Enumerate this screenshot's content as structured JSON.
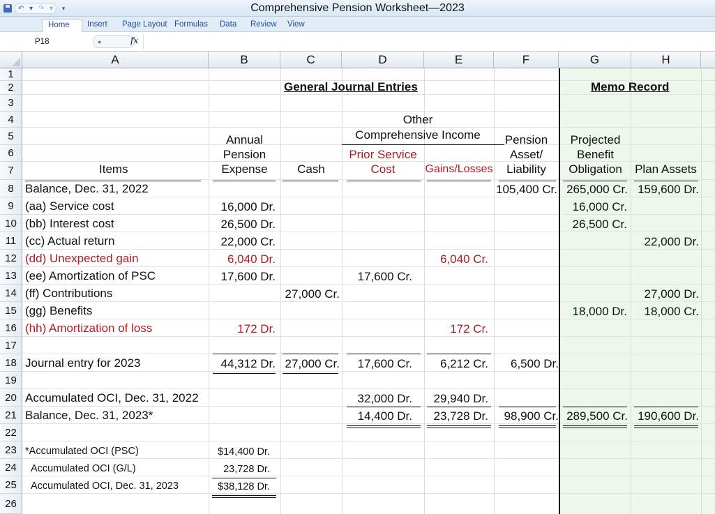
{
  "window": {
    "title": "Comprehensive Pension Worksheet—2023"
  },
  "ribbon": {
    "tabs": [
      "Home",
      "Insert",
      "Page Layout",
      "Formulas",
      "Data",
      "Review",
      "View"
    ]
  },
  "formula_bar": {
    "cell_ref": "P18",
    "fx": "fx",
    "value": ""
  },
  "columns": [
    "A",
    "B",
    "C",
    "D",
    "E",
    "F",
    "G",
    "H"
  ],
  "rows": [
    "1",
    "2",
    "3",
    "4",
    "5",
    "6",
    "7",
    "8",
    "9",
    "10",
    "11",
    "12",
    "13",
    "14",
    "15",
    "16",
    "17",
    "18",
    "19",
    "20",
    "21",
    "22",
    "23",
    "24",
    "25",
    "26"
  ],
  "headers": {
    "general_journal": "General Journal Entries",
    "memo_record": "Memo Record",
    "other_line1": "Other",
    "other_line2": "Comprehensive Income",
    "annual_1": "Annual",
    "annual_2": "Pension",
    "annual_3": "Expense",
    "cash": "Cash",
    "psc_1": "Prior Service",
    "psc_2": "Cost",
    "gains": "Gains/Losses",
    "pal_1": "Pension",
    "pal_2": "Asset/",
    "pal_3": "Liability",
    "pbo_1": "Projected",
    "pbo_2": "Benefit",
    "pbo_3": "Obligation",
    "plan": "Plan Assets",
    "items": "Items"
  },
  "entries": {
    "r8": {
      "item": "Balance, Dec. 31, 2022",
      "f": "105,400 Cr.",
      "g": "265,000 Cr.",
      "h": "159,600 Dr."
    },
    "r9": {
      "item": "(aa) Service cost",
      "b": "16,000 Dr.",
      "g": "16,000 Cr."
    },
    "r10": {
      "item": "(bb) Interest cost",
      "b": "26,500 Dr.",
      "g": "26,500 Cr."
    },
    "r11": {
      "item": "(cc) Actual return",
      "b": "22,000 Cr.",
      "h": "22,000 Dr."
    },
    "r12": {
      "item": "(dd) Unexpected gain",
      "b": "6,040 Dr.",
      "e": "6,040 Cr."
    },
    "r13": {
      "item": "(ee) Amortization of PSC",
      "b": "17,600 Dr.",
      "d": "17,600 Cr."
    },
    "r14": {
      "item": "(ff) Contributions",
      "c": "27,000 Cr.",
      "h": "27,000 Dr."
    },
    "r15": {
      "item": "(gg) Benefits",
      "g": "18,000 Dr.",
      "h": "18,000 Cr."
    },
    "r16": {
      "item": "(hh) Amortization of loss",
      "b": "172 Dr.",
      "e": "172 Cr."
    },
    "r18": {
      "item": "Journal entry for 2023",
      "b": "44,312 Dr.",
      "c": "27,000 Cr.",
      "d": "17,600 Cr.",
      "e": "6,212 Cr.",
      "f": "6,500 Dr."
    },
    "r20": {
      "item": "Accumulated OCI, Dec. 31, 2022",
      "d": "32,000 Dr.",
      "e": "29,940 Dr."
    },
    "r21": {
      "item": "Balance, Dec. 31, 2023*",
      "d": "14,400 Dr.",
      "e": "23,728 Dr.",
      "f": "98,900 Cr.",
      "g": "289,500 Cr.",
      "h": "190,600 Dr."
    },
    "r23": {
      "item": "*Accumulated OCI (PSC)",
      "b": "$14,400 Dr."
    },
    "r24": {
      "item": "Accumulated OCI (G/L)",
      "b": "23,728 Dr."
    },
    "r25": {
      "item": "Accumulated OCI, Dec. 31, 2023",
      "b": "$38,128 Dr."
    }
  },
  "colors": {
    "red_text": "#b01c22",
    "memo_fill": "#edf7ec",
    "ribbon_text": "#1f4e96"
  }
}
